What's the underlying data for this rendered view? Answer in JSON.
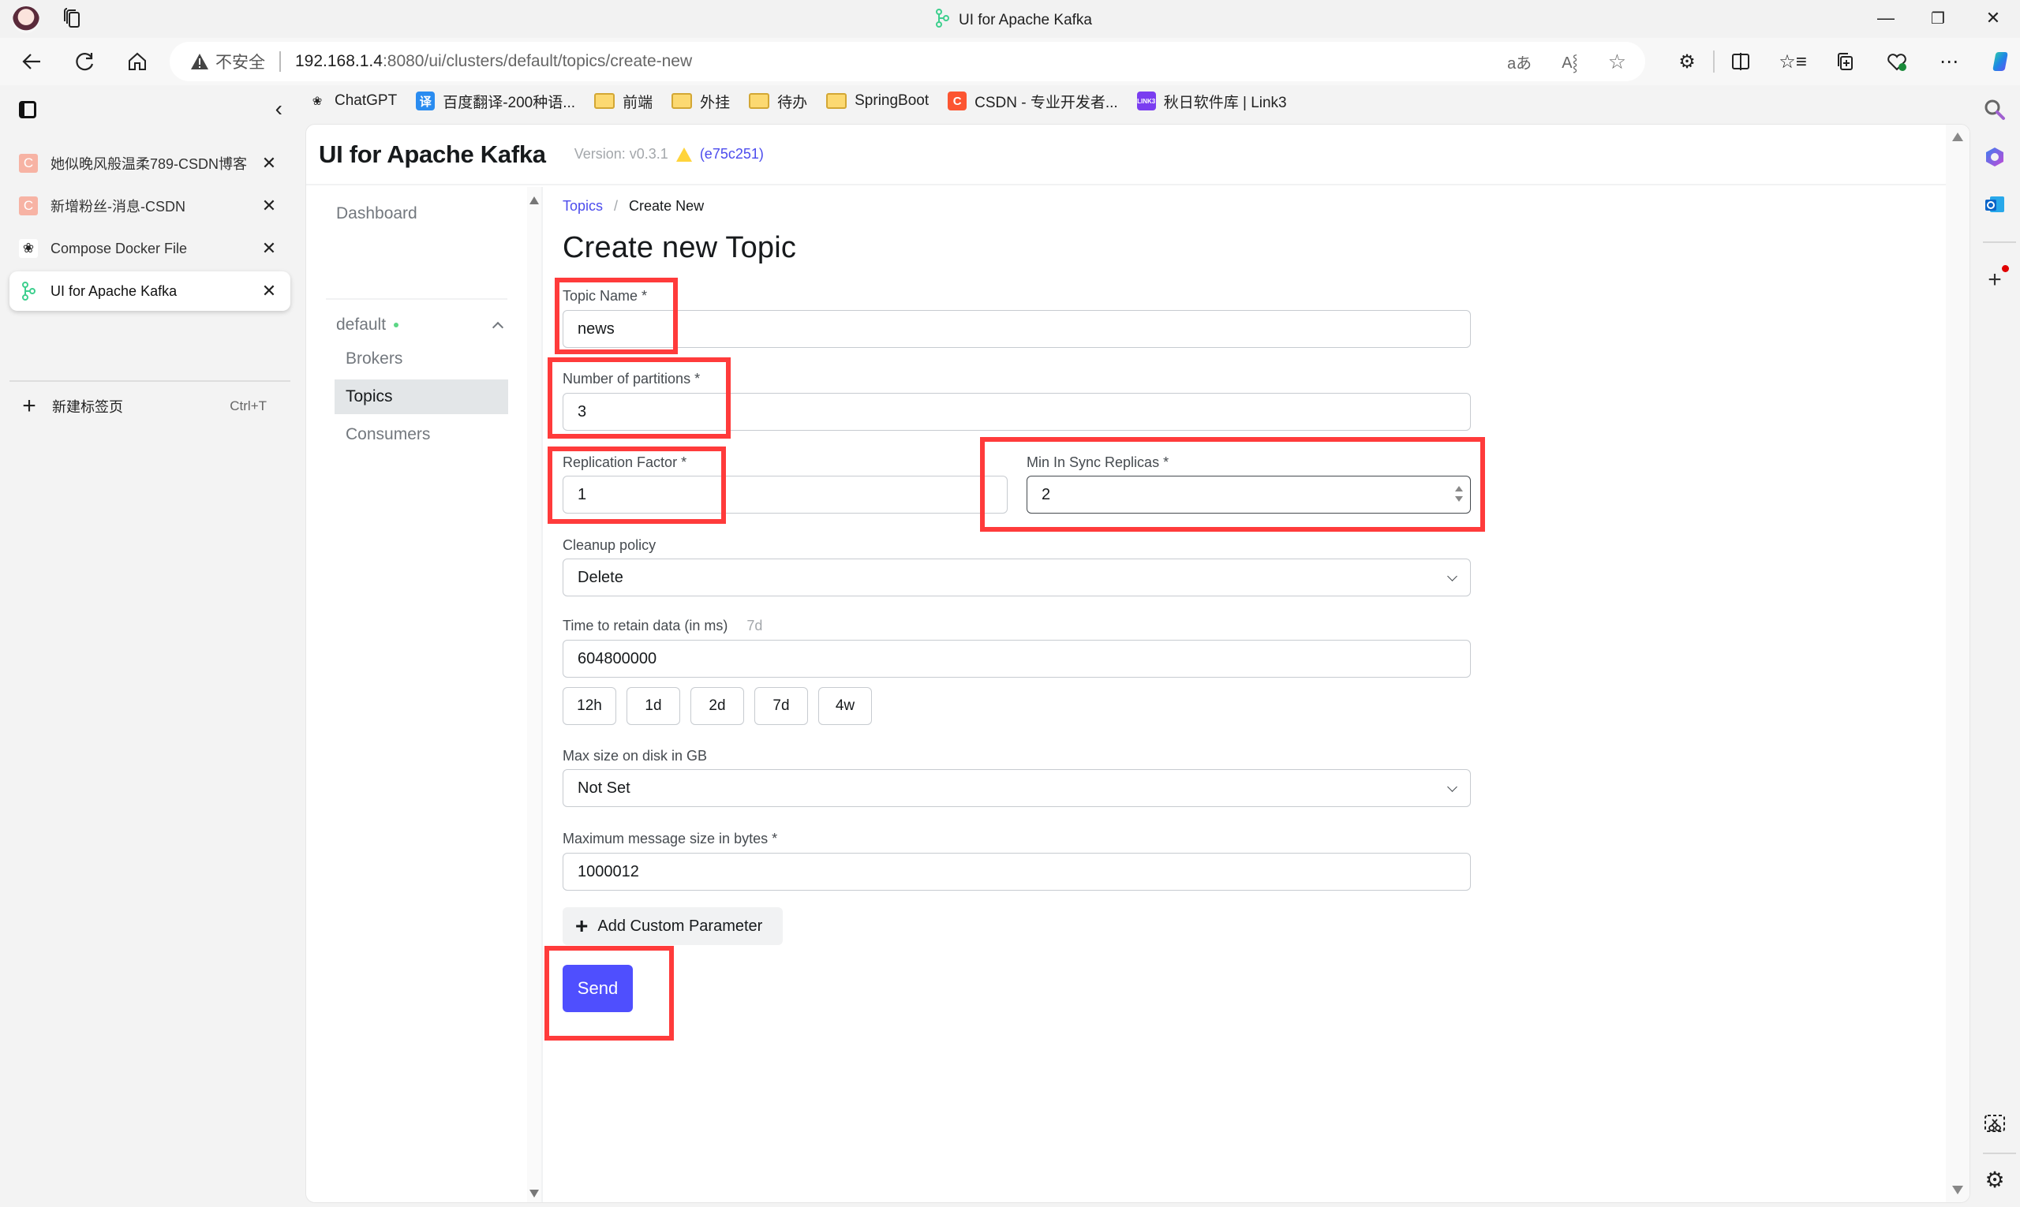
{
  "window": {
    "title": "UI for Apache Kafka",
    "controls": [
      "minimize",
      "restore",
      "close"
    ]
  },
  "address_bar": {
    "security_label": "不安全",
    "url_host": "192.168.1.4",
    "url_path": ":8080/ui/clusters/default/topics/create-new",
    "right_icons": [
      "translate-icon",
      "read-aloud-icon",
      "favorite-star-icon"
    ]
  },
  "toolbar": {
    "icons": [
      "extensions-icon",
      "split-screen-icon",
      "favorites-icon",
      "collections-icon",
      "browser-essentials-icon",
      "more-icon",
      "copilot-icon"
    ]
  },
  "bookmarks": [
    {
      "label": "ChatGPT",
      "type": "site",
      "icon": "chatgpt-icon"
    },
    {
      "label": "百度翻译-200种语...",
      "type": "site",
      "icon": "baidu-translate-icon"
    },
    {
      "label": "前端",
      "type": "folder",
      "icon": "folder-icon"
    },
    {
      "label": "外挂",
      "type": "folder",
      "icon": "folder-icon"
    },
    {
      "label": "待办",
      "type": "folder",
      "icon": "folder-icon"
    },
    {
      "label": "SpringBoot",
      "type": "folder",
      "icon": "folder-icon"
    },
    {
      "label": "CSDN - 专业开发者...",
      "type": "site",
      "icon": "csdn-icon"
    },
    {
      "label": "秋日软件库 | Link3",
      "type": "site",
      "icon": "link3-icon"
    }
  ],
  "vertical_tabs": {
    "tabs": [
      {
        "label": "她似晚风般温柔789-CSDN博客",
        "icon": "csdn-icon",
        "active": false
      },
      {
        "label": "新增粉丝-消息-CSDN",
        "icon": "csdn-icon",
        "active": false
      },
      {
        "label": "Compose Docker File",
        "icon": "chatgpt-icon",
        "active": false
      },
      {
        "label": "UI for Apache Kafka",
        "icon": "kafka-icon",
        "active": true
      }
    ],
    "new_tab_label": "新建标签页",
    "new_tab_shortcut": "Ctrl+T"
  },
  "app": {
    "title": "UI for Apache Kafka",
    "version": "Version: v0.3.1",
    "commit": "(e75c251)"
  },
  "sidebar": {
    "dashboard": "Dashboard",
    "cluster": {
      "name": "default",
      "status": "online",
      "expanded": true
    },
    "items": [
      {
        "label": "Brokers",
        "active": false
      },
      {
        "label": "Topics",
        "active": true
      },
      {
        "label": "Consumers",
        "active": false
      }
    ]
  },
  "breadcrumb": {
    "parent": "Topics",
    "separator": "/",
    "current": "Create New"
  },
  "form": {
    "heading": "Create new Topic",
    "topic_name": {
      "label": "Topic Name *",
      "value": "news"
    },
    "partitions": {
      "label": "Number of partitions *",
      "value": "3"
    },
    "replication_factor": {
      "label": "Replication Factor *",
      "value": "1"
    },
    "min_insync_replicas": {
      "label": "Min In Sync Replicas *",
      "value": "2"
    },
    "cleanup_policy": {
      "label": "Cleanup policy",
      "value": "Delete"
    },
    "retention": {
      "label": "Time to retain data (in ms)",
      "hint": "7d",
      "value": "604800000",
      "presets": [
        "12h",
        "1d",
        "2d",
        "7d",
        "4w"
      ]
    },
    "max_size": {
      "label": "Max size on disk in GB",
      "value": "Not Set"
    },
    "max_message_size": {
      "label": "Maximum message size in bytes *",
      "value": "1000012"
    },
    "add_param_label": "Add Custom Parameter",
    "submit_label": "Send"
  },
  "colors": {
    "accent": "#4f4ffe",
    "link": "#4c4ced",
    "status_online": "#5cd685",
    "annotation": "#ff3b3b",
    "warning": "#ffd43b"
  },
  "edge_sidebar": {
    "icons": [
      "search-icon",
      "microsoft365-icon",
      "outlook-icon",
      "add-icon",
      "screenshot-icon",
      "settings-icon"
    ]
  }
}
